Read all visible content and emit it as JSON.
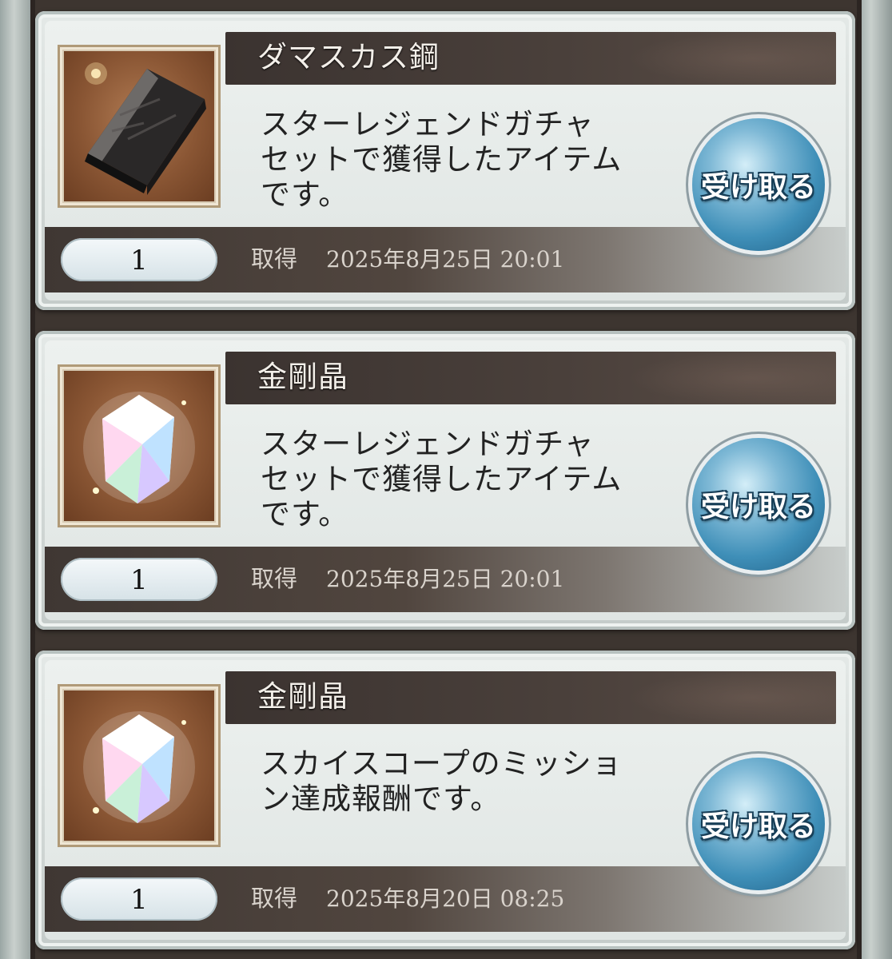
{
  "acquired_label": "取得",
  "receive_label": "受け取る",
  "items": [
    {
      "name": "ダマスカス鋼",
      "icon": "damascus-steel-ingot-icon",
      "description": "スターレジェンドガチャ\nセットで獲得したアイテム\nです。",
      "quantity": "1",
      "acquired_at": "2025年8月25日 20:01"
    },
    {
      "name": "金剛晶",
      "icon": "adamantite-crystal-icon",
      "description": "スターレジェンドガチャ\nセットで獲得したアイテム\nです。",
      "quantity": "1",
      "acquired_at": "2025年8月25日 20:01"
    },
    {
      "name": "金剛晶",
      "icon": "adamantite-crystal-icon",
      "description": "スカイスコープのミッショ\nン達成報酬です。",
      "quantity": "1",
      "acquired_at": "2025年8月20日 08:25"
    }
  ]
}
